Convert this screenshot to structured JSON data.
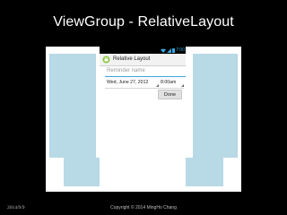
{
  "slide": {
    "title": "ViewGroup - RelativeLayout",
    "footer_left": "2014/9/9",
    "footer_center": "Copyright © 2014 MingHo Chang"
  },
  "phone": {
    "status_time": "7:00",
    "app_title": "Relative Layout",
    "reminder_placeholder": "Reminder name",
    "date_value": "Wed, June 27, 2012",
    "time_value": "8:00am",
    "done_label": "Done"
  },
  "colors": {
    "slide_background": "#000000",
    "diagram_cell": "#b8d9e6",
    "holo_blue": "#3aa6dd",
    "app_icon_green": "#8bc53f"
  },
  "icons": [
    "wifi-icon",
    "signal-icon",
    "battery-icon",
    "android-app-icon",
    "spinner-arrow-icon"
  ]
}
